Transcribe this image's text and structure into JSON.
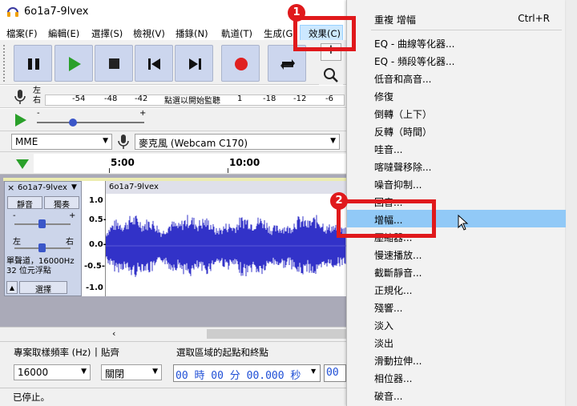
{
  "window": {
    "title": "6o1a7-9lvex"
  },
  "menubar": {
    "items": [
      "檔案(F)",
      "編輯(E)",
      "選擇(S)",
      "檢視(V)",
      "播錄(N)",
      "軌道(T)",
      "生成(G)",
      "效果(C)"
    ]
  },
  "meter": {
    "channels": "左\n右",
    "scale": [
      "-54",
      "-48",
      "-42",
      "點選以開始監聽",
      "1",
      "-18",
      "-12",
      "-6"
    ],
    "play_scale": [
      "-",
      "+"
    ]
  },
  "devices": {
    "host": "MME",
    "mic": "麥克風 (Webcam C170)"
  },
  "timeline": {
    "ticks": [
      "5:00",
      "10:00"
    ]
  },
  "track": {
    "name": "6o1a7-9lvex",
    "mute": "靜音",
    "solo": "獨奏",
    "gain_minus": "-",
    "gain_plus": "+",
    "pan_left": "左",
    "pan_right": "右",
    "info": "單聲道，16000Hz\n32 位元浮點",
    "select": "選擇",
    "clip_name": "6o1a7-9lvex",
    "yaxis": [
      "1.0",
      "0.5-",
      "0.0-",
      "-0.5-",
      "-1.0"
    ]
  },
  "bottom": {
    "rate_label": "專案取樣頻率 (Hz)",
    "snap_label": "貼齊",
    "sel_label": "選取區域的起點和終點",
    "rate_value": "16000",
    "snap_value": "關閉",
    "time_value": "00 時 00 分 00.000 秒",
    "time_value2": "00"
  },
  "status": {
    "text": "已停止。"
  },
  "dropdown": {
    "items": [
      {
        "label": "重複 增幅",
        "shortcut": "Ctrl+R"
      },
      {
        "label": "EQ - 曲線等化器..."
      },
      {
        "label": "EQ - 頻段等化器..."
      },
      {
        "label": "低音和高音..."
      },
      {
        "label": "修復"
      },
      {
        "label": "倒轉（上下）"
      },
      {
        "label": "反轉（時間）"
      },
      {
        "label": "哇音..."
      },
      {
        "label": "喀噠聲移除..."
      },
      {
        "label": "噪音抑制..."
      },
      {
        "label": "回音..."
      },
      {
        "label": "增幅..."
      },
      {
        "label": "壓縮器..."
      },
      {
        "label": "慢速播放..."
      },
      {
        "label": "截斷靜音..."
      },
      {
        "label": "正規化..."
      },
      {
        "label": "殘響..."
      },
      {
        "label": "淡入"
      },
      {
        "label": "淡出"
      },
      {
        "label": "滑動拉伸..."
      },
      {
        "label": "相位器..."
      },
      {
        "label": "破音..."
      }
    ]
  },
  "callouts": {
    "one": "1",
    "two": "2"
  },
  "colors": {
    "waveform": "#3232c8",
    "highlight": "#91c9f7",
    "callout": "#e0191c"
  }
}
